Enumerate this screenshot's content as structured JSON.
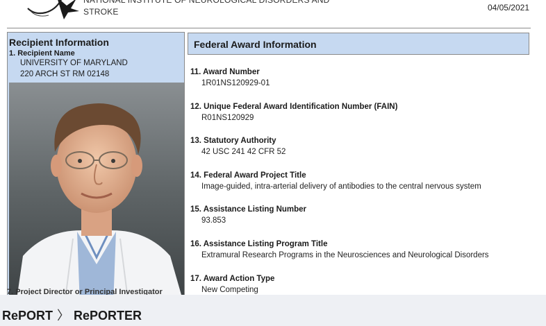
{
  "header": {
    "agency_line1": "National Institute of Neurological Disorders and",
    "agency_line2": "Stroke",
    "date": "04/05/2021"
  },
  "recipient": {
    "title": "Recipient Information",
    "name_label": "1. Recipient Name",
    "name": "UNIVERSITY OF MARYLAND",
    "address": "220 ARCH ST RM 02148",
    "next_label_partial": "7. Project Director or Principal Investigator"
  },
  "federal": {
    "title": "Federal Award Information",
    "fields": [
      {
        "label": "11. Award Number",
        "value": "1R01NS120929-01"
      },
      {
        "label": "12. Unique Federal Award Identification Number (FAIN)",
        "value": "R01NS120929"
      },
      {
        "label": "13. Statutory Authority",
        "value": "42 USC 241  42 CFR 52"
      },
      {
        "label": "14. Federal Award Project Title",
        "value": "Image-guided, intra-arterial delivery of antibodies to the central nervous system"
      },
      {
        "label": "15. Assistance Listing Number",
        "value": "93.853"
      },
      {
        "label": "16. Assistance Listing Program Title",
        "value": "Extramural Research Programs in the Neurosciences and Neurological Disorders"
      },
      {
        "label": "17. Award Action Type",
        "value": "New Competing"
      }
    ]
  },
  "breadcrumb": {
    "root": "RePORT",
    "separator": "〉",
    "current": "RePORTER"
  },
  "colors": {
    "panel_blue": "#c6d9f1",
    "border_gray": "#8a8a8a",
    "bottom_bar": "#eef0f4"
  },
  "icons": {
    "logo": "nih-eagle-logo"
  }
}
